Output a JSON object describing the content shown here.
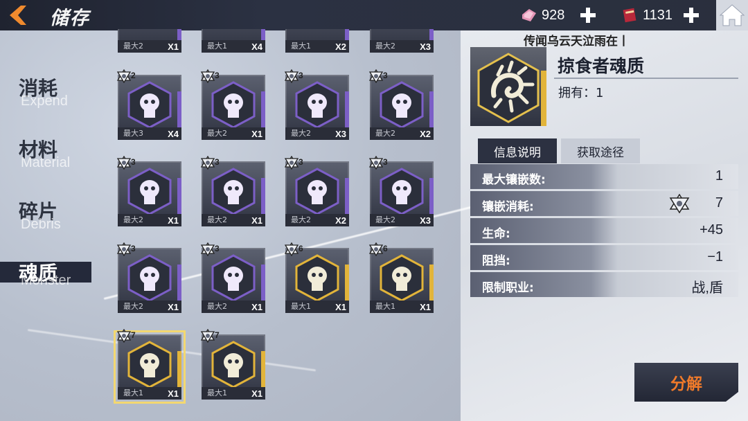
{
  "header": {
    "title": "储存",
    "resource1": "928",
    "resource2": "1131"
  },
  "ticker": "传闻乌云天泣雨在丨",
  "menu": [
    {
      "zh": "消耗",
      "en": "Expend"
    },
    {
      "zh": "材料",
      "en": "Material"
    },
    {
      "zh": "碎片",
      "en": "Debris"
    },
    {
      "zh": "魂质",
      "en": "Monster"
    }
  ],
  "partial_row": [
    {
      "max": "最大2",
      "count": "X1"
    },
    {
      "max": "最大1",
      "count": "X4"
    },
    {
      "max": "最大1",
      "count": "X2"
    },
    {
      "max": "最大2",
      "count": "X3"
    }
  ],
  "items": [
    {
      "level": "2",
      "max": "最大3",
      "count": "X4",
      "rarity": "purple",
      "icon": "horned-beast-icon"
    },
    {
      "level": "3",
      "max": "最大2",
      "count": "X1",
      "rarity": "purple",
      "icon": "octopus-icon"
    },
    {
      "level": "3",
      "max": "最大2",
      "count": "X3",
      "rarity": "purple",
      "icon": "sword-shield-icon"
    },
    {
      "level": "3",
      "max": "最大2",
      "count": "X2",
      "rarity": "purple",
      "icon": "demon-mask-icon"
    },
    {
      "level": "3",
      "max": "最大2",
      "count": "X1",
      "rarity": "purple",
      "icon": "helmet-skull-icon"
    },
    {
      "level": "3",
      "max": "最大2",
      "count": "X1",
      "rarity": "purple",
      "icon": "fortress-fist-icon"
    },
    {
      "level": "3",
      "max": "最大2",
      "count": "X2",
      "rarity": "purple",
      "icon": "spiked-mask-icon"
    },
    {
      "level": "3",
      "max": "最大2",
      "count": "X3",
      "rarity": "purple",
      "icon": "hooded-figure-icon"
    },
    {
      "level": "3",
      "max": "最大2",
      "count": "X1",
      "rarity": "purple",
      "icon": "jaws-beast-icon"
    },
    {
      "level": "3",
      "max": "最大2",
      "count": "X1",
      "rarity": "purple",
      "icon": "wolf-head-icon"
    },
    {
      "level": "6",
      "max": "最大1",
      "count": "X1",
      "rarity": "gold",
      "icon": "insect-skull-icon"
    },
    {
      "level": "6",
      "max": "最大1",
      "count": "X1",
      "rarity": "gold",
      "icon": "anchor-shield-icon"
    },
    {
      "level": "7",
      "max": "最大1",
      "count": "X1",
      "rarity": "gold",
      "icon": "predator-swirl-icon"
    },
    {
      "level": "7",
      "max": "最大1",
      "count": "X1",
      "rarity": "gold",
      "icon": "gear-cog-icon"
    }
  ],
  "detail": {
    "name": "掠食者魂质",
    "owned": "拥有：1",
    "tab_info": "信息说明",
    "tab_source": "获取途径",
    "rows": [
      {
        "label": "最大镶嵌数:",
        "value": "1"
      },
      {
        "label": "镶嵌消耗:",
        "value": "7"
      },
      {
        "label": "生命:",
        "value": "+45"
      },
      {
        "label": "阻挡:",
        "value": "−1"
      },
      {
        "label": "限制职业:",
        "value": "战,盾"
      }
    ]
  },
  "actions": {
    "decompose": "分解"
  },
  "colors": {
    "purple": "#7c5fc7",
    "gold": "#e2b43a",
    "accent": "#f07a2a"
  }
}
